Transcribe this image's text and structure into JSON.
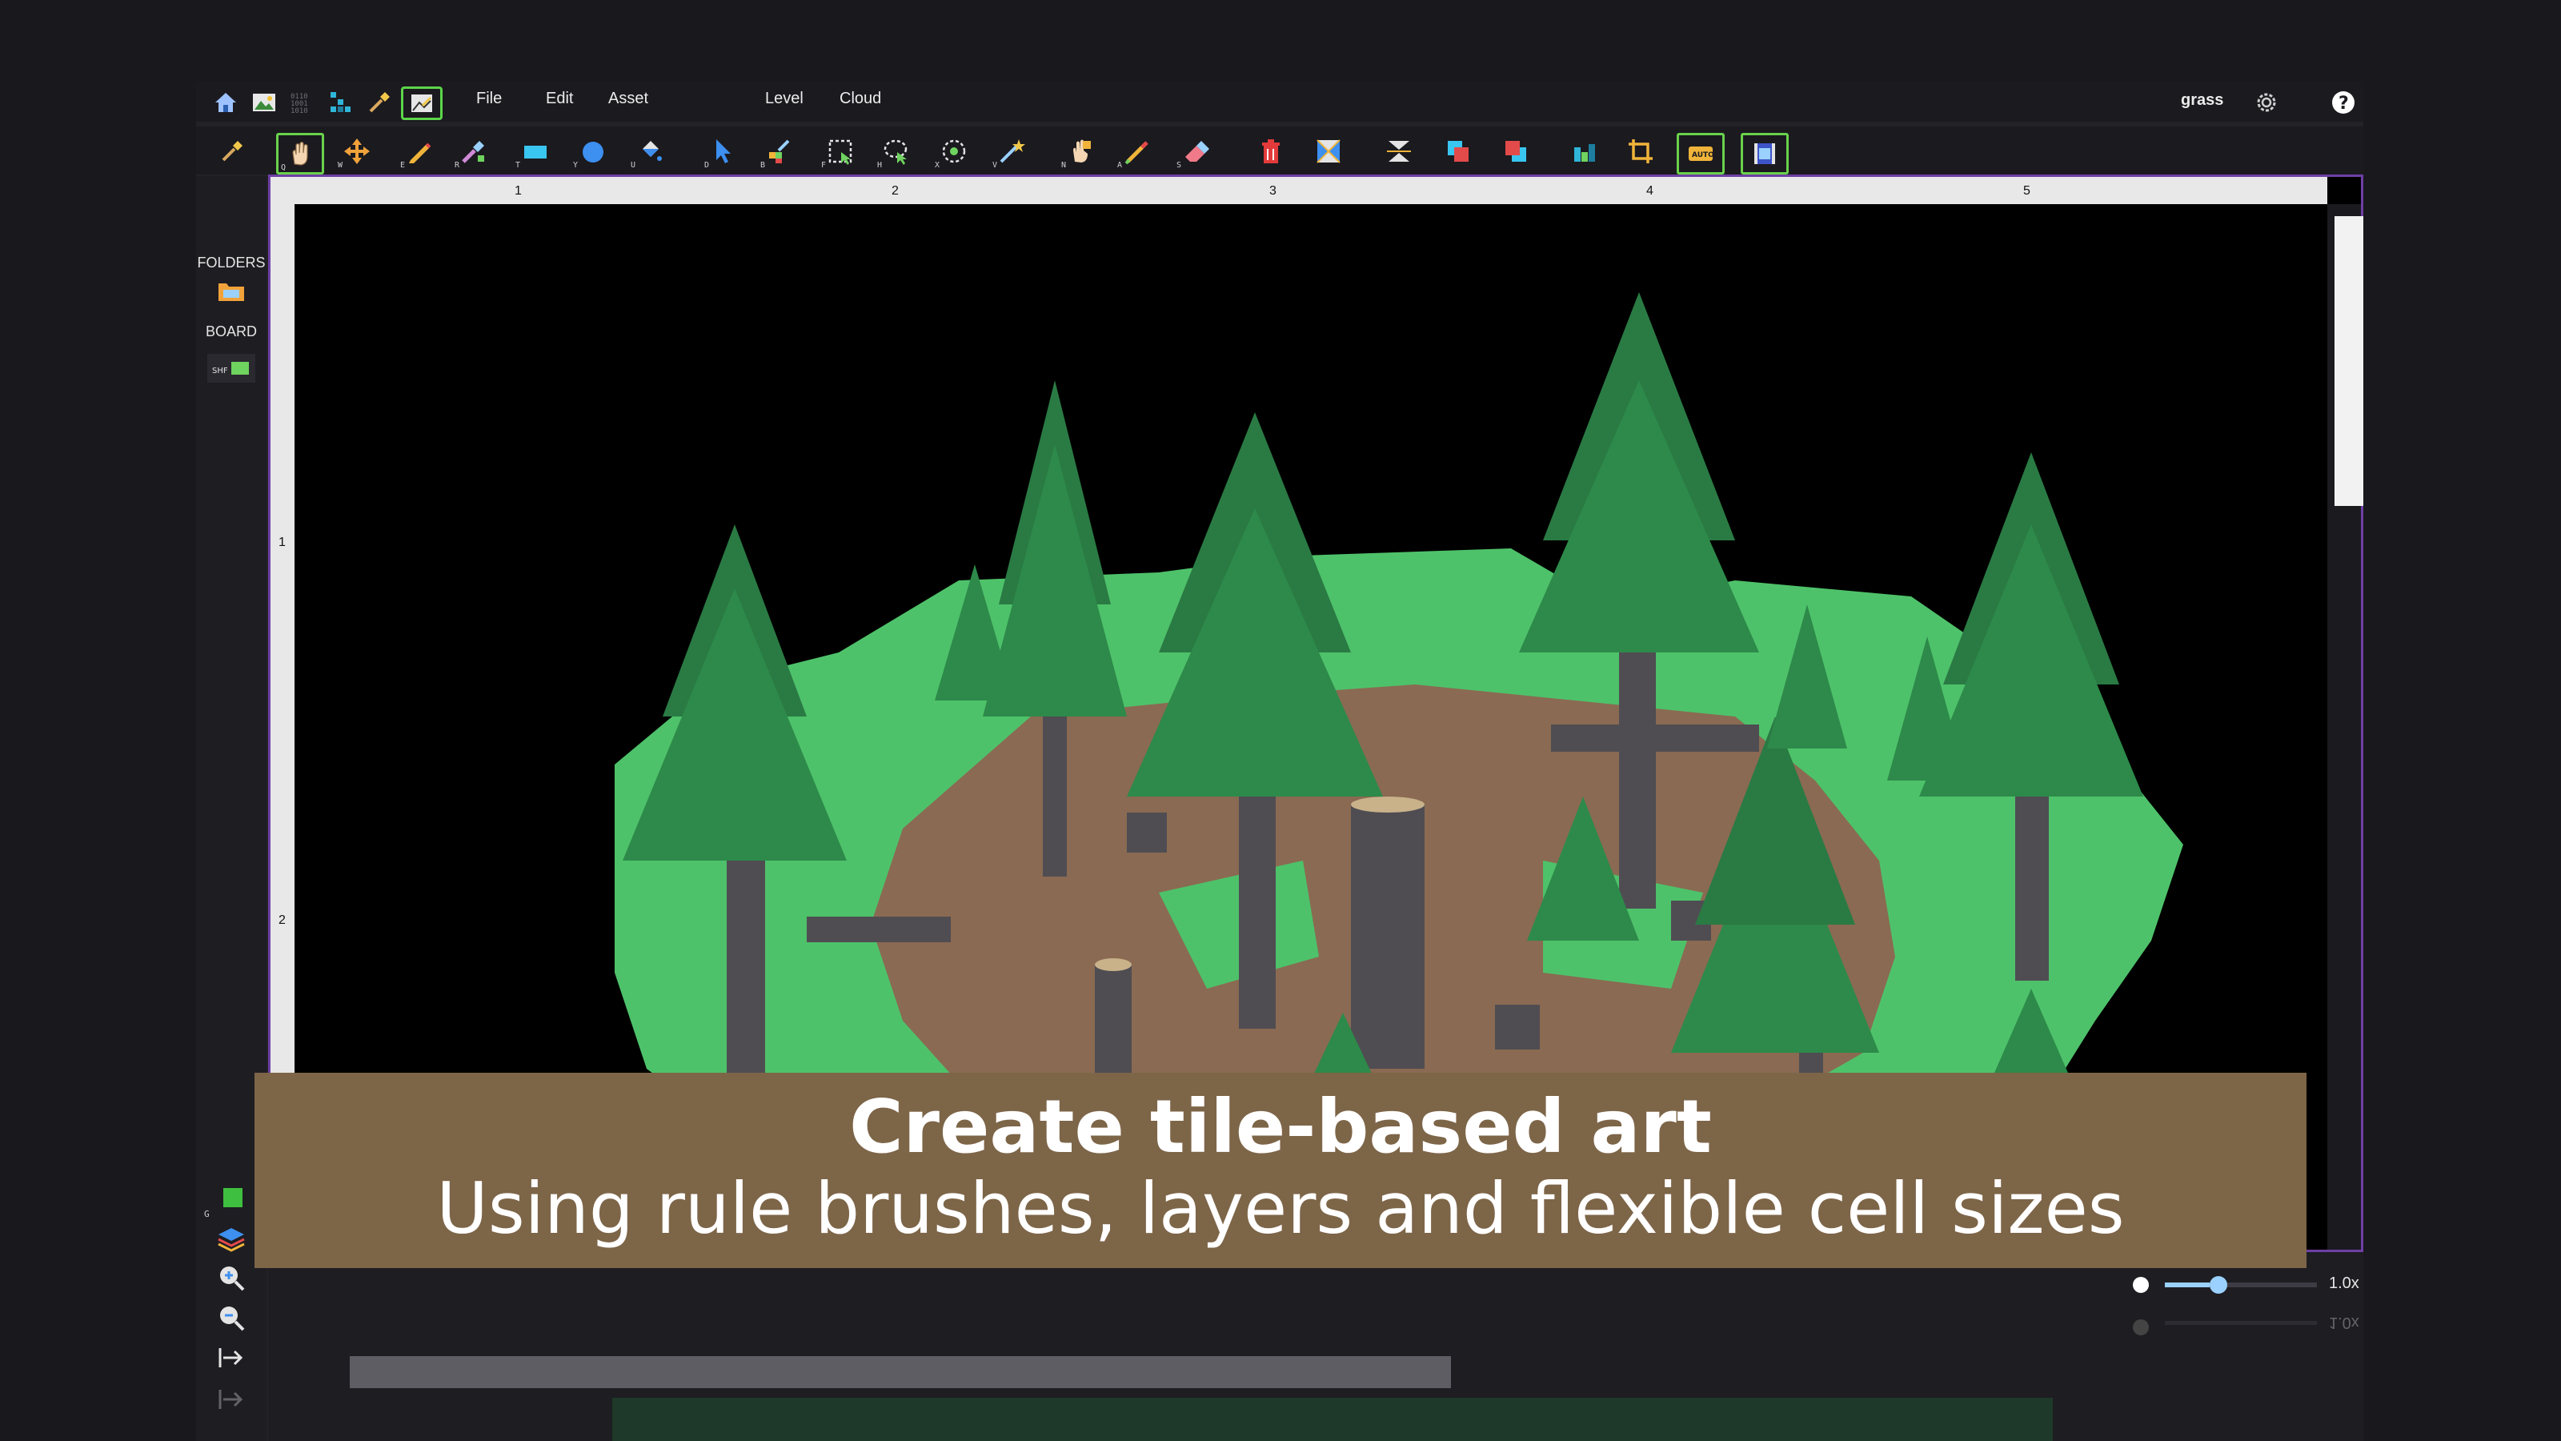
{
  "menu": {
    "file": "File",
    "edit": "Edit",
    "asset": "Asset",
    "level": "Level",
    "cloud": "Cloud",
    "active_brush": "grass"
  },
  "toolbar_keys": [
    "Q",
    "W",
    "E",
    "R",
    "T",
    "Y",
    "U",
    "D",
    "B",
    "F",
    "H",
    "X",
    "V",
    "N",
    "A",
    "S"
  ],
  "sidebar": {
    "folders": "FOLDERS",
    "board": "BOARD",
    "layer_key": "G"
  },
  "rulers": {
    "top": [
      "1",
      "2",
      "3",
      "4",
      "5"
    ],
    "left": [
      "1",
      "2"
    ]
  },
  "zoom": {
    "value": "1.0x",
    "mirror_value": "1.0x"
  },
  "banner": {
    "title": "Create tile-based art",
    "subtitle": "Using rule brushes, layers and flexible cell sizes"
  },
  "colors": {
    "accent_green": "#5cd54a",
    "frame_purple": "#6e3fa5",
    "banner_brown": "#7d6548"
  }
}
